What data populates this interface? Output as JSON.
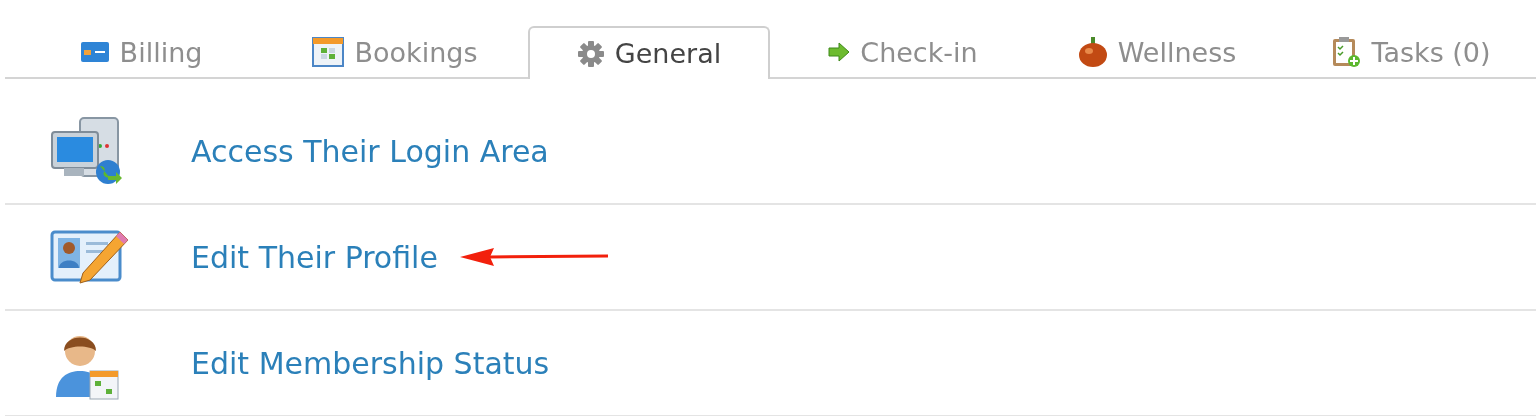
{
  "tabs": [
    {
      "label": "Billing",
      "selected": false
    },
    {
      "label": "Bookings",
      "selected": false
    },
    {
      "label": "General",
      "selected": true
    },
    {
      "label": "Check-in",
      "selected": false
    },
    {
      "label": "Wellness",
      "selected": false
    },
    {
      "label": "Tasks (0)",
      "selected": false
    }
  ],
  "actions": [
    {
      "label": "Access Their Login Area",
      "pointed": false
    },
    {
      "label": "Edit Their Profile",
      "pointed": true
    },
    {
      "label": "Edit Membership Status",
      "pointed": false
    }
  ]
}
